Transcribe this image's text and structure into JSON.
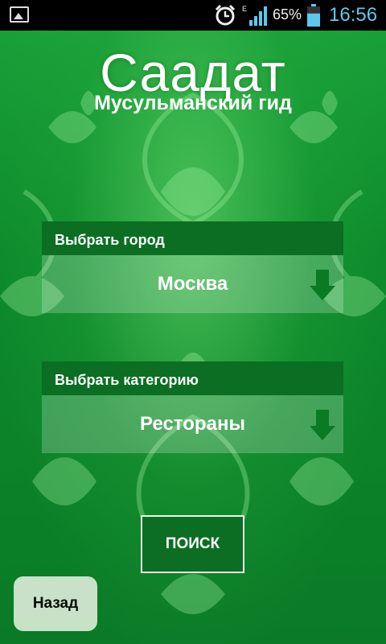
{
  "status_bar": {
    "network": "E",
    "battery_percent": "65%",
    "time": "16:56",
    "battery_level": 0.65,
    "icons": [
      "gallery-icon",
      "alarm-clock-icon",
      "signal-icon",
      "battery-icon"
    ]
  },
  "app": {
    "title": "Саадат",
    "subtitle": "Мусульманский гид"
  },
  "city_select": {
    "label": "Выбрать город",
    "value": "Москва"
  },
  "category_select": {
    "label": "Выбрать категорию",
    "value": "Рестораны"
  },
  "actions": {
    "search_label": "ПОИСК",
    "back_label": "Назад"
  },
  "colors": {
    "background": "#0a7a2a",
    "panel_header": "#0b6e22",
    "arrow": "#0b7a25",
    "time": "#5bc8ee"
  }
}
